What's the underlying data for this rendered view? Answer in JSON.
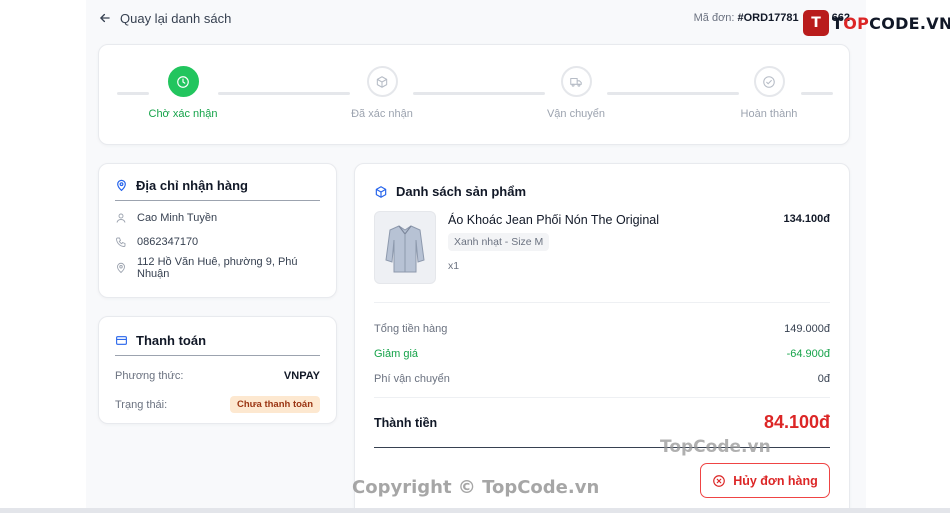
{
  "header": {
    "back_label": "Quay lại danh sách",
    "order_label": "Mã đơn:",
    "order_code": "#ORD17781",
    "order_code_tail": "662"
  },
  "logo": {
    "mark": "T",
    "text_prefix": "T",
    "text_highlight": "OP",
    "text_suffix": "CODE.VN"
  },
  "steps": [
    {
      "label": "Chờ xác nhận",
      "icon": "clock-icon",
      "active": true
    },
    {
      "label": "Đã xác nhận",
      "icon": "box-icon",
      "active": false
    },
    {
      "label": "Vận chuyển",
      "icon": "truck-icon",
      "active": false
    },
    {
      "label": "Hoàn thành",
      "icon": "check-circle-icon",
      "active": false
    }
  ],
  "address": {
    "title": "Địa chỉ nhận hàng",
    "name": "Cao Minh Tuyền",
    "phone": "0862347170",
    "street": "112 Hồ Văn Huê, phường 9, Phú Nhuận"
  },
  "payment": {
    "title": "Thanh toán",
    "method_label": "Phương thức:",
    "method_value": "VNPAY",
    "status_label": "Trạng thái:",
    "status_value": "Chưa thanh toán"
  },
  "products": {
    "title": "Danh sách sản phẩm",
    "items": [
      {
        "name": "Áo Khoác Jean Phối Nón The Original",
        "variant": "Xanh nhạt - Size M",
        "qty": "x1",
        "price": "134.100đ"
      }
    ]
  },
  "summary": {
    "subtotal_label": "Tổng tiền hàng",
    "subtotal": "149.000đ",
    "discount_label": "Giảm giá",
    "discount": "-64.900đ",
    "shipping_label": "Phí vận chuyển",
    "shipping": "0đ",
    "total_label": "Thành tiền",
    "total": "84.100đ"
  },
  "cancel_label": "Hủy đơn hàng",
  "watermarks": {
    "a": "TopCode.vn",
    "b": "Copyright © TopCode.vn"
  },
  "colors": {
    "accent_green": "#22c55e",
    "danger": "#dc2626",
    "badge_bg": "#fde8d0"
  }
}
